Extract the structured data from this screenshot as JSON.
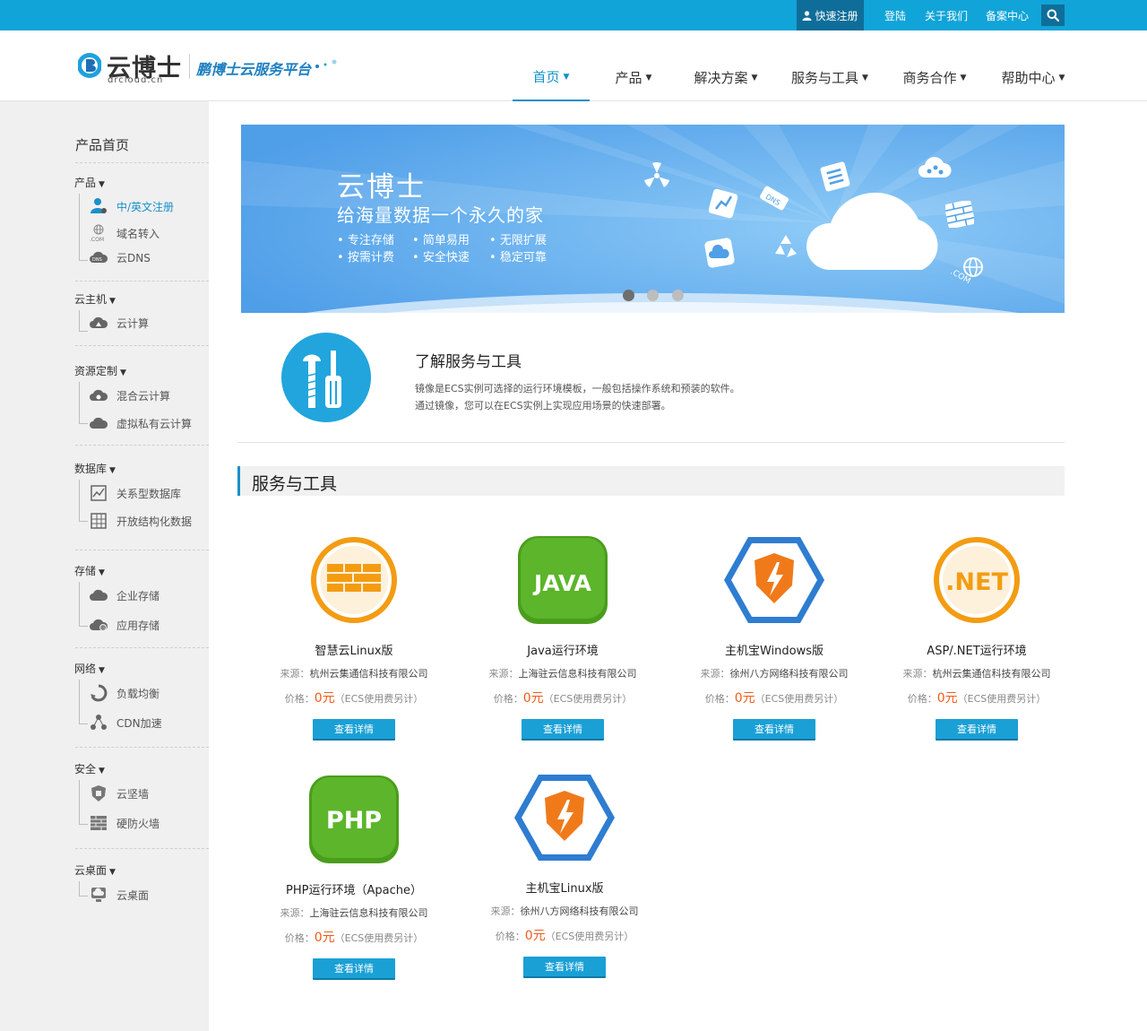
{
  "topbar": {
    "register": "快速注册",
    "login": "登陆",
    "about": "关于我们",
    "icp": "备案中心",
    "search_icon": "search-icon"
  },
  "header": {
    "logo_name": "云博士",
    "logo_domain": "drcloud.cn",
    "slogan": "鹏博士云服务平台",
    "nav": [
      {
        "label": "首页",
        "active": true
      },
      {
        "label": "产品",
        "active": false
      },
      {
        "label": "解决方案",
        "active": false
      },
      {
        "label": "服务与工具",
        "active": false
      },
      {
        "label": "商务合作",
        "active": false
      },
      {
        "label": "帮助中心",
        "active": false
      }
    ]
  },
  "sidebar": {
    "home": "产品首页",
    "groups": [
      {
        "title": "产品",
        "items": [
          {
            "label": "中/英文注册",
            "icon": "user-icon",
            "active": true
          },
          {
            "label": "域名转入",
            "icon": "globe-com-icon"
          },
          {
            "label": "云DNS",
            "icon": "dns-cloud-icon"
          }
        ]
      },
      {
        "title": "云主机",
        "items": [
          {
            "label": "云计算",
            "icon": "cloud-compute-icon"
          }
        ]
      },
      {
        "title": "资源定制",
        "items": [
          {
            "label": "混合云计算",
            "icon": "hybrid-cloud-icon"
          },
          {
            "label": "虚拟私有云计算",
            "icon": "private-cloud-icon"
          }
        ]
      },
      {
        "title": "数据库",
        "items": [
          {
            "label": "关系型数据库",
            "icon": "chart-icon"
          },
          {
            "label": "开放结构化数据",
            "icon": "grid-icon"
          }
        ]
      },
      {
        "title": "存储",
        "items": [
          {
            "label": "企业存储",
            "icon": "cloud-storage-icon"
          },
          {
            "label": "应用存储",
            "icon": "cloud-gear-icon"
          }
        ]
      },
      {
        "title": "网络",
        "items": [
          {
            "label": "负载均衡",
            "icon": "recycle-icon"
          },
          {
            "label": "CDN加速",
            "icon": "network-nodes-icon"
          }
        ]
      },
      {
        "title": "安全",
        "items": [
          {
            "label": "云坚墙",
            "icon": "shield-icon"
          },
          {
            "label": "硬防火墙",
            "icon": "firewall-icon"
          }
        ]
      },
      {
        "title": "云桌面",
        "items": [
          {
            "label": "云桌面",
            "icon": "cloud-desktop-icon"
          }
        ]
      }
    ]
  },
  "banner": {
    "title": "云博士",
    "subtitle": "给海量数据一个永久的家",
    "features": [
      "专注存储",
      "简单易用",
      "无限扩展",
      "按需计费",
      "安全快速",
      "稳定可靠"
    ],
    "cloud_tags": [
      "DNS",
      ".COM"
    ],
    "dots": 3,
    "active_dot": 0
  },
  "intro": {
    "title": "了解服务与工具",
    "lines": [
      "镜像是ECS实例可选择的运行环境模板，一般包括操作系统和预装的软件。",
      "通过镜像，您可以在ECS实例上实现应用场景的快速部署。"
    ],
    "icon": "tools-icon"
  },
  "section": {
    "title": "服务与工具"
  },
  "cards": [
    {
      "name": "智慧云Linux版",
      "src_label": "来源：",
      "source": "杭州云集通信科技有限公司",
      "price_label": "价格：",
      "price": "0元",
      "price_note": "（ECS使用费另计）",
      "button": "查看详情",
      "icon": "wall-badge-icon"
    },
    {
      "name": "Java运行环境",
      "src_label": "来源：",
      "source": "上海驻云信息科技有限公司",
      "price_label": "价格：",
      "price": "0元",
      "price_note": "（ECS使用费另计）",
      "button": "查看详情",
      "icon": "java-icon",
      "icon_text": "JAVA"
    },
    {
      "name": "主机宝Windows版",
      "src_label": "来源：",
      "source": "徐州八方网络科技有限公司",
      "price_label": "价格：",
      "price": "0元",
      "price_note": "（ECS使用费另计）",
      "button": "查看详情",
      "icon": "hex-shield-icon"
    },
    {
      "name": "ASP/.NET运行环境",
      "src_label": "来源：",
      "source": "杭州云集通信科技有限公司",
      "price_label": "价格：",
      "price": "0元",
      "price_note": "（ECS使用费另计）",
      "button": "查看详情",
      "icon": "dotnet-icon",
      "icon_text": ".NET"
    },
    {
      "name": "PHP运行环境（Apache）",
      "src_label": "来源：",
      "source": "上海驻云信息科技有限公司",
      "price_label": "价格：",
      "price": "0元",
      "price_note": "（ECS使用费另计）",
      "button": "查看详情",
      "icon": "php-icon",
      "icon_text": "PHP"
    },
    {
      "name": "主机宝Linux版",
      "src_label": "来源：",
      "source": "徐州八方网络科技有限公司",
      "price_label": "价格：",
      "price": "0元",
      "price_note": "（ECS使用费另计）",
      "button": "查看详情",
      "icon": "hex-shield-icon"
    }
  ],
  "colors": {
    "topbar": "#11a4d8",
    "accent": "#1390c7",
    "price": "#f05a1a",
    "button": "#1aa0d5",
    "sidebar_bg": "#f0f0f0"
  }
}
